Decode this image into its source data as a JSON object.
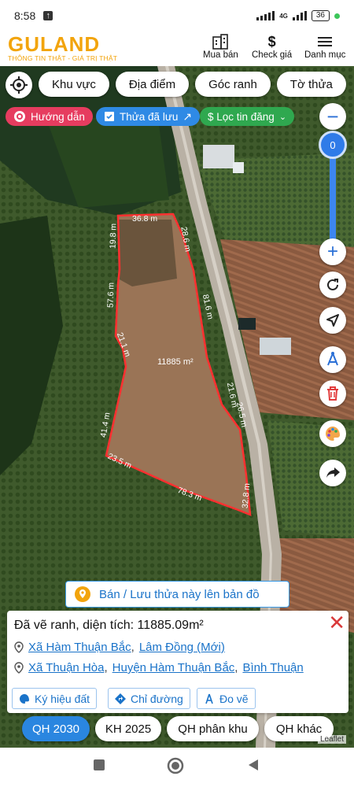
{
  "status": {
    "time": "8:58",
    "battery": "36",
    "network": "4G"
  },
  "header": {
    "logo": "GULAND",
    "tagline": "THÔNG TIN THẬT - GIÁ TRỊ THẬT",
    "buttons": [
      {
        "label": "Mua bán",
        "icon": "building-icon"
      },
      {
        "label": "Check giá",
        "icon": "dollar-icon"
      },
      {
        "label": "Danh mục",
        "icon": "menu-icon"
      }
    ]
  },
  "search_chips": [
    "Khu vực",
    "Địa điểm",
    "Góc ranh",
    "Tờ thửa"
  ],
  "pills": {
    "guide": "Hướng dẫn",
    "saved": "Thửa đã lưu",
    "filter": "$ Lọc tin đăng"
  },
  "zoom_level": "0",
  "parcel": {
    "area_label": "11885 m²",
    "edge_labels": [
      "36.8 m",
      "28.6 m",
      "81.6 m",
      "21.6 m",
      "26.5 m",
      "32.8 m",
      "78.3 m",
      "23.5 m",
      "41.4 m",
      "21.1 m",
      "57.6 m",
      "19.8 m"
    ]
  },
  "sell_banner": "Bán / Lưu thửa này lên bản đồ",
  "card": {
    "title": "Đã vẽ ranh, diện tích: 11885.09m²",
    "address_new": [
      "Xã Hàm Thuận Bắc",
      "Lâm Đồng (Mới)"
    ],
    "address_old": [
      "Xã Thuận Hòa",
      "Huyện Hàm Thuận Bắc",
      "Bình Thuận"
    ],
    "buttons": [
      "Ký hiệu đất",
      "Chỉ đường",
      "Đo vẽ"
    ]
  },
  "qh_tabs": [
    "QH 2030",
    "KH 2025",
    "QH phân khu",
    "QH khác"
  ],
  "attribution": "Leaflet",
  "colors": {
    "accent": "#2a86e0",
    "brand": "#f2a40c",
    "parcel_line": "#ff3030",
    "guide_pill": "#e63c5f",
    "saved_pill": "#2f8ae5",
    "filter_pill": "#2fa84f"
  }
}
